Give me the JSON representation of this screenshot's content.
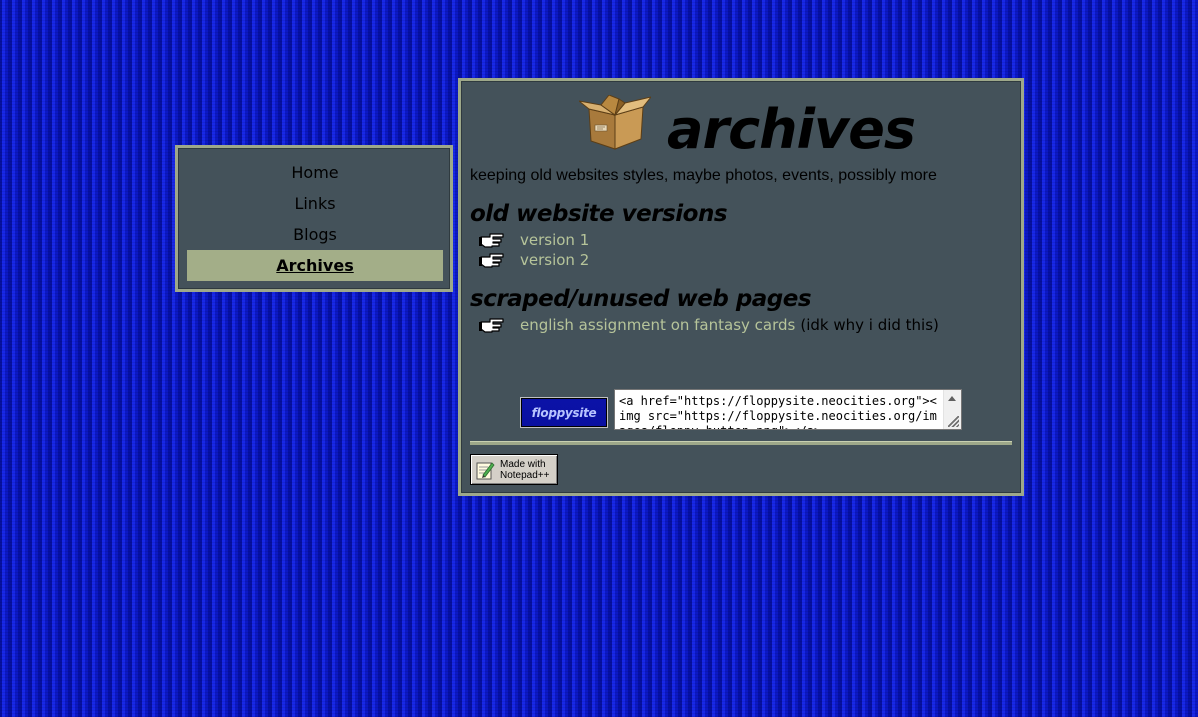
{
  "nav": {
    "items": [
      {
        "label": "Home"
      },
      {
        "label": "Links"
      },
      {
        "label": "Blogs"
      },
      {
        "label": "Archives"
      }
    ],
    "active_item": "Archives"
  },
  "header": {
    "title": "archives",
    "icon": "cardboard-box-icon"
  },
  "tagline": "keeping old websites styles, maybe photos, events, possibly more",
  "sections": [
    {
      "title": "old website versions",
      "links": [
        {
          "label": "version 1"
        },
        {
          "label": "version 2"
        }
      ]
    },
    {
      "title": "scraped/unused web pages",
      "links": [
        {
          "label": "english assignment on fantasy cards",
          "note": "(idk why i did this)"
        }
      ]
    }
  ],
  "banner": {
    "label": "floppysite",
    "embed_code": "<a href=\"https://floppysite.neocities.org\"><img src=\"https://floppysite.neocities.org/images/floppy-button.png\"></a>"
  },
  "badge": {
    "line1": "Made with",
    "line2": "Notepad++"
  },
  "colors": {
    "background": "#0a14c8",
    "panel": "#44525a",
    "border": "#9ea88a",
    "active_nav": "#a3ae88",
    "link": "#b6c49a"
  }
}
